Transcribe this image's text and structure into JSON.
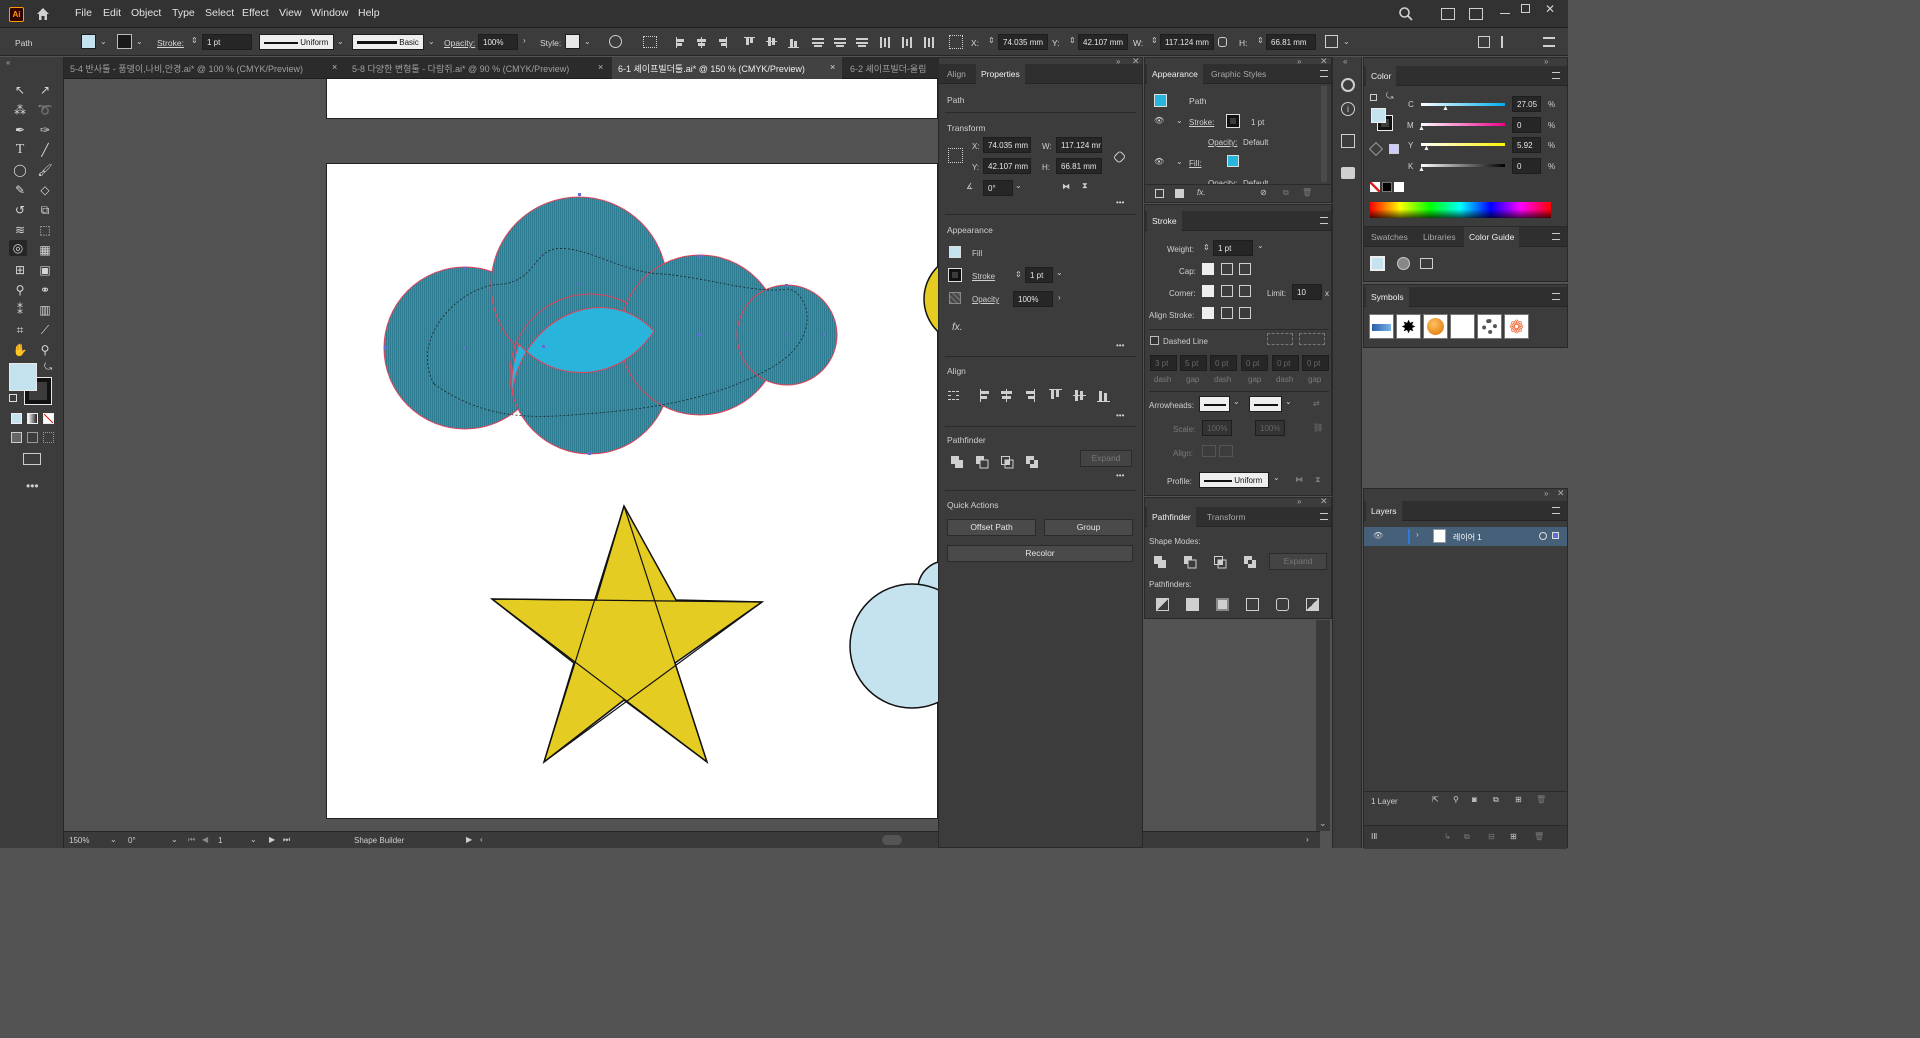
{
  "app": {
    "logo": "Ai"
  },
  "menu": [
    "File",
    "Edit",
    "Object",
    "Type",
    "Select",
    "Effect",
    "View",
    "Window",
    "Help"
  ],
  "control": {
    "object_type": "Path",
    "stroke_label": "Stroke:",
    "stroke_weight": "1 pt",
    "uniform": "Uniform",
    "basic": "Basic",
    "opacity_label": "Opacity:",
    "opacity": "100%",
    "style_label": "Style:",
    "x_label": "X:",
    "x": "74.035 mm",
    "y_label": "Y:",
    "y": "42.107 mm",
    "w_label": "W:",
    "w": "117.124 mm",
    "h_label": "H:",
    "h": "66.81 mm"
  },
  "tabs": [
    {
      "label": "5-4 반사툴 - 풍뎅이,나비,안경.ai* @ 100 % (CMYK/Preview)",
      "active": false
    },
    {
      "label": "5-8 다양한 변형툴 - 다람쥐.ai* @ 90 % (CMYK/Preview)",
      "active": false
    },
    {
      "label": "6-1 셰이프빌더툴.ai* @ 150 % (CMYK/Preview)",
      "active": true
    },
    {
      "label": "6-2 셰이프빌더-올림",
      "active": false
    }
  ],
  "status": {
    "zoom": "150%",
    "rotation": "0°",
    "artboard": "1",
    "tool": "Shape Builder"
  },
  "properties": {
    "tab_align": "Align",
    "tab_properties": "Properties",
    "object_type": "Path",
    "transform_title": "Transform",
    "x_label": "X:",
    "x": "74.035 mm",
    "w_label": "W:",
    "w": "117.124 mr",
    "y_label": "Y:",
    "y": "42.107 mm",
    "h_label": "H:",
    "h": "66.81 mm",
    "angle": "0°",
    "appearance_title": "Appearance",
    "fill_label": "Fill",
    "stroke_label": "Stroke",
    "stroke_weight": "1 pt",
    "opacity_label": "Opacity",
    "opacity": "100%",
    "fx": "fx.",
    "align_title": "Align",
    "pathfinder_title": "Pathfinder",
    "expand": "Expand",
    "quick_actions_title": "Quick Actions",
    "offset_path": "Offset Path",
    "group": "Group",
    "recolor": "Recolor"
  },
  "appearance": {
    "tab1": "Appearance",
    "tab2": "Graphic Styles",
    "path_label": "Path",
    "stroke_label": "Stroke:",
    "stroke_value": "1 pt",
    "opacity_label": "Opacity:",
    "opacity_value": "Default",
    "fill_label": "Fill:",
    "opacity2_label": "Opacity:",
    "opacity2_value": "Default",
    "fx": "fx."
  },
  "stroke_panel": {
    "title": "Stroke",
    "weight_label": "Weight:",
    "weight": "1 pt",
    "cap_label": "Cap:",
    "corner_label": "Corner:",
    "limit_label": "Limit:",
    "limit": "10",
    "limit_unit": "x",
    "align_label": "Align Stroke:",
    "dashed_label": "Dashed Line",
    "dash_values": [
      "3 pt",
      "5 pt",
      "0 pt",
      "0 pt",
      "0 pt",
      "0 pt"
    ],
    "dash_labels": [
      "dash",
      "gap",
      "dash",
      "gap",
      "dash",
      "gap"
    ],
    "arrowheads_label": "Arrowheads:",
    "scale_label": "Scale:",
    "scale1": "100%",
    "scale2": "100%",
    "align2_label": "Align:",
    "profile_label": "Profile:",
    "profile": "Uniform"
  },
  "pathfinder_panel": {
    "tab1": "Pathfinder",
    "tab2": "Transform",
    "shape_modes": "Shape Modes:",
    "expand": "Expand",
    "pathfinders": "Pathfinders:"
  },
  "color": {
    "title": "Color",
    "channels": [
      {
        "name": "C",
        "value": "27.05",
        "fraction": 0.2705,
        "gradient": "linear-gradient(90deg,#ffffff,#00aeef)"
      },
      {
        "name": "M",
        "value": "0",
        "fraction": 0,
        "gradient": "linear-gradient(90deg,#ffffff,#ec008c)"
      },
      {
        "name": "Y",
        "value": "5.92",
        "fraction": 0.0592,
        "gradient": "linear-gradient(90deg,#ffffff,#fff200)"
      },
      {
        "name": "K",
        "value": "0",
        "fraction": 0,
        "gradient": "linear-gradient(90deg,#ffffff,#000000)"
      }
    ],
    "percent": "%"
  },
  "swatch_tabs": {
    "swatches": "Swatches",
    "libraries": "Libraries",
    "color_guide": "Color Guide"
  },
  "symbols": {
    "title": "Symbols"
  },
  "layers": {
    "title": "Layers",
    "layer_name": "레이어 1",
    "footer": "1 Layer"
  },
  "colors": {
    "cloud_fill": "#3a92ab",
    "cloud_highlight": "#29b5db",
    "selection": "#e0435a",
    "star": "#e5cc22",
    "light_blue": "#c5e3ee",
    "ui_bg": "#535353",
    "panel_bg": "#3c3c3c"
  }
}
